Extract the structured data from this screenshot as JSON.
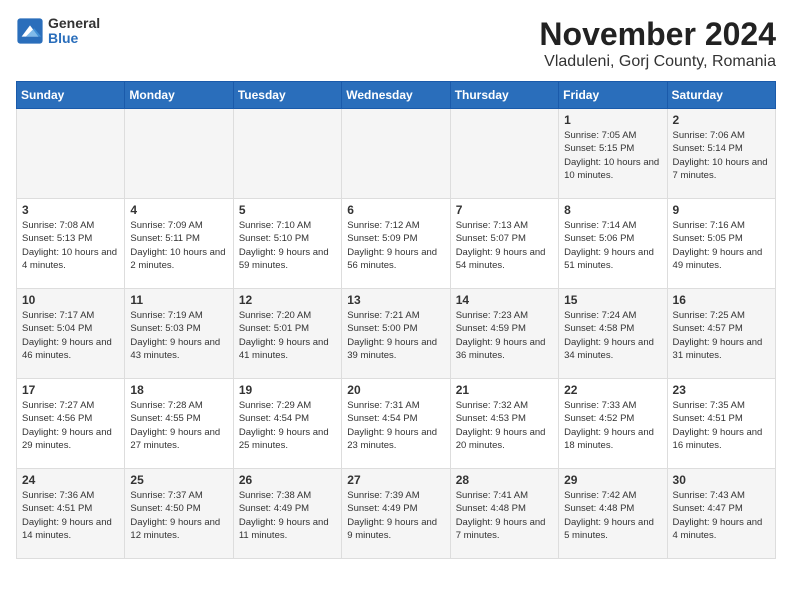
{
  "logo": {
    "general": "General",
    "blue": "Blue"
  },
  "title": "November 2024",
  "subtitle": "Vladuleni, Gorj County, Romania",
  "days_of_week": [
    "Sunday",
    "Monday",
    "Tuesday",
    "Wednesday",
    "Thursday",
    "Friday",
    "Saturday"
  ],
  "weeks": [
    [
      {
        "day": "",
        "info": ""
      },
      {
        "day": "",
        "info": ""
      },
      {
        "day": "",
        "info": ""
      },
      {
        "day": "",
        "info": ""
      },
      {
        "day": "",
        "info": ""
      },
      {
        "day": "1",
        "info": "Sunrise: 7:05 AM\nSunset: 5:15 PM\nDaylight: 10 hours and 10 minutes."
      },
      {
        "day": "2",
        "info": "Sunrise: 7:06 AM\nSunset: 5:14 PM\nDaylight: 10 hours and 7 minutes."
      }
    ],
    [
      {
        "day": "3",
        "info": "Sunrise: 7:08 AM\nSunset: 5:13 PM\nDaylight: 10 hours and 4 minutes."
      },
      {
        "day": "4",
        "info": "Sunrise: 7:09 AM\nSunset: 5:11 PM\nDaylight: 10 hours and 2 minutes."
      },
      {
        "day": "5",
        "info": "Sunrise: 7:10 AM\nSunset: 5:10 PM\nDaylight: 9 hours and 59 minutes."
      },
      {
        "day": "6",
        "info": "Sunrise: 7:12 AM\nSunset: 5:09 PM\nDaylight: 9 hours and 56 minutes."
      },
      {
        "day": "7",
        "info": "Sunrise: 7:13 AM\nSunset: 5:07 PM\nDaylight: 9 hours and 54 minutes."
      },
      {
        "day": "8",
        "info": "Sunrise: 7:14 AM\nSunset: 5:06 PM\nDaylight: 9 hours and 51 minutes."
      },
      {
        "day": "9",
        "info": "Sunrise: 7:16 AM\nSunset: 5:05 PM\nDaylight: 9 hours and 49 minutes."
      }
    ],
    [
      {
        "day": "10",
        "info": "Sunrise: 7:17 AM\nSunset: 5:04 PM\nDaylight: 9 hours and 46 minutes."
      },
      {
        "day": "11",
        "info": "Sunrise: 7:19 AM\nSunset: 5:03 PM\nDaylight: 9 hours and 43 minutes."
      },
      {
        "day": "12",
        "info": "Sunrise: 7:20 AM\nSunset: 5:01 PM\nDaylight: 9 hours and 41 minutes."
      },
      {
        "day": "13",
        "info": "Sunrise: 7:21 AM\nSunset: 5:00 PM\nDaylight: 9 hours and 39 minutes."
      },
      {
        "day": "14",
        "info": "Sunrise: 7:23 AM\nSunset: 4:59 PM\nDaylight: 9 hours and 36 minutes."
      },
      {
        "day": "15",
        "info": "Sunrise: 7:24 AM\nSunset: 4:58 PM\nDaylight: 9 hours and 34 minutes."
      },
      {
        "day": "16",
        "info": "Sunrise: 7:25 AM\nSunset: 4:57 PM\nDaylight: 9 hours and 31 minutes."
      }
    ],
    [
      {
        "day": "17",
        "info": "Sunrise: 7:27 AM\nSunset: 4:56 PM\nDaylight: 9 hours and 29 minutes."
      },
      {
        "day": "18",
        "info": "Sunrise: 7:28 AM\nSunset: 4:55 PM\nDaylight: 9 hours and 27 minutes."
      },
      {
        "day": "19",
        "info": "Sunrise: 7:29 AM\nSunset: 4:54 PM\nDaylight: 9 hours and 25 minutes."
      },
      {
        "day": "20",
        "info": "Sunrise: 7:31 AM\nSunset: 4:54 PM\nDaylight: 9 hours and 23 minutes."
      },
      {
        "day": "21",
        "info": "Sunrise: 7:32 AM\nSunset: 4:53 PM\nDaylight: 9 hours and 20 minutes."
      },
      {
        "day": "22",
        "info": "Sunrise: 7:33 AM\nSunset: 4:52 PM\nDaylight: 9 hours and 18 minutes."
      },
      {
        "day": "23",
        "info": "Sunrise: 7:35 AM\nSunset: 4:51 PM\nDaylight: 9 hours and 16 minutes."
      }
    ],
    [
      {
        "day": "24",
        "info": "Sunrise: 7:36 AM\nSunset: 4:51 PM\nDaylight: 9 hours and 14 minutes."
      },
      {
        "day": "25",
        "info": "Sunrise: 7:37 AM\nSunset: 4:50 PM\nDaylight: 9 hours and 12 minutes."
      },
      {
        "day": "26",
        "info": "Sunrise: 7:38 AM\nSunset: 4:49 PM\nDaylight: 9 hours and 11 minutes."
      },
      {
        "day": "27",
        "info": "Sunrise: 7:39 AM\nSunset: 4:49 PM\nDaylight: 9 hours and 9 minutes."
      },
      {
        "day": "28",
        "info": "Sunrise: 7:41 AM\nSunset: 4:48 PM\nDaylight: 9 hours and 7 minutes."
      },
      {
        "day": "29",
        "info": "Sunrise: 7:42 AM\nSunset: 4:48 PM\nDaylight: 9 hours and 5 minutes."
      },
      {
        "day": "30",
        "info": "Sunrise: 7:43 AM\nSunset: 4:47 PM\nDaylight: 9 hours and 4 minutes."
      }
    ]
  ]
}
